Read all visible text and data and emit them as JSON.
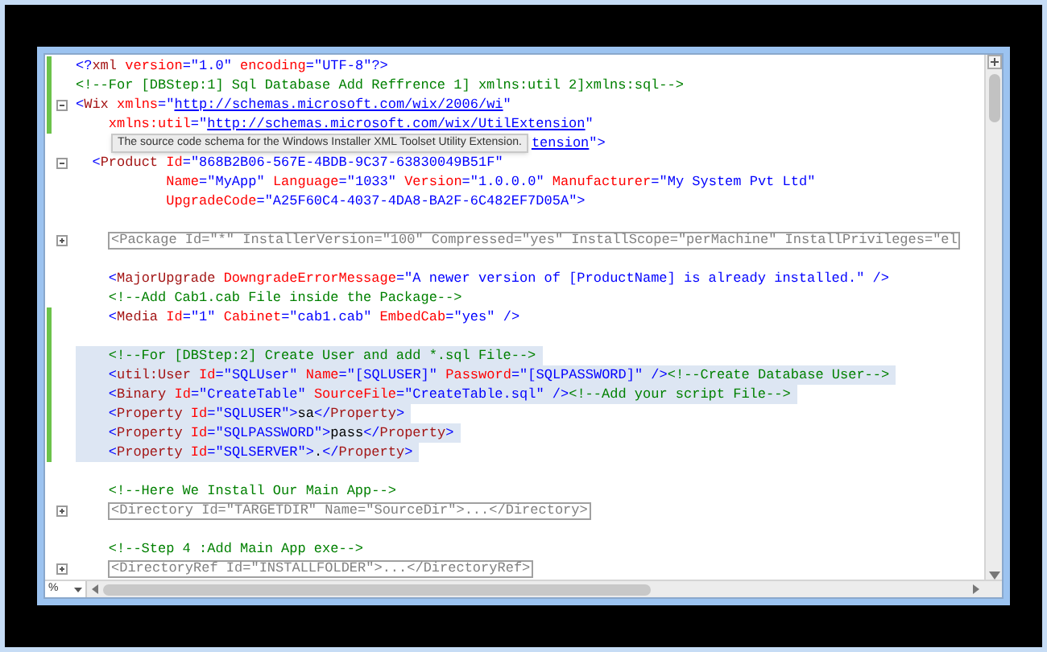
{
  "editor": {
    "lines": [
      {
        "changed": true,
        "segments": [
          {
            "kind": "delim",
            "text": "<?"
          },
          {
            "kind": "element",
            "text": "xml"
          },
          {
            "kind": "attr",
            "text": " version"
          },
          {
            "kind": "delim",
            "text": "=\""
          },
          {
            "kind": "value",
            "text": "1.0"
          },
          {
            "kind": "delim",
            "text": "\""
          },
          {
            "kind": "attr",
            "text": " encoding"
          },
          {
            "kind": "delim",
            "text": "=\""
          },
          {
            "kind": "value",
            "text": "UTF-8"
          },
          {
            "kind": "delim",
            "text": "\"?>"
          }
        ]
      },
      {
        "changed": true,
        "segments": [
          {
            "kind": "comment",
            "text": "<!--For [DBStep:1] Sql Database Add Reffrence 1] xmlns:util 2]xmlns:sql-->"
          }
        ]
      },
      {
        "changed": true,
        "expanded": true,
        "segments": [
          {
            "kind": "delim",
            "text": "<"
          },
          {
            "kind": "element",
            "text": "Wix"
          },
          {
            "kind": "attr",
            "text": " xmlns"
          },
          {
            "kind": "delim",
            "text": "=\""
          },
          {
            "kind": "link",
            "text": "http://schemas.microsoft.com/wix/2006/wi"
          },
          {
            "kind": "delim",
            "text": "\""
          }
        ]
      },
      {
        "changed": true,
        "segments": [
          {
            "kind": "attr",
            "text": "    xmlns:util"
          },
          {
            "kind": "delim",
            "text": "=\""
          },
          {
            "kind": "link",
            "text": "http://schemas.microsoft.com/wix/UtilExtension"
          },
          {
            "kind": "delim",
            "text": "\""
          }
        ]
      },
      {
        "changed": false,
        "tooltip": "The source code schema for the Windows Installer XML Toolset Utility Extension.",
        "segments": [
          {
            "kind": "link",
            "text": "tension"
          },
          {
            "kind": "delim",
            "text": "\">"
          }
        ]
      },
      {
        "changed": false,
        "expanded": true,
        "segments": [
          {
            "kind": "delim",
            "text": "  <"
          },
          {
            "kind": "element",
            "text": "Product"
          },
          {
            "kind": "attr",
            "text": " Id"
          },
          {
            "kind": "delim",
            "text": "=\""
          },
          {
            "kind": "value",
            "text": "868B2B06-567E-4BDB-9C37-63830049B51F"
          },
          {
            "kind": "delim",
            "text": "\""
          }
        ]
      },
      {
        "changed": false,
        "segments": [
          {
            "kind": "attr",
            "text": "           Name"
          },
          {
            "kind": "delim",
            "text": "=\""
          },
          {
            "kind": "value",
            "text": "MyApp"
          },
          {
            "kind": "delim",
            "text": "\""
          },
          {
            "kind": "attr",
            "text": " Language"
          },
          {
            "kind": "delim",
            "text": "=\""
          },
          {
            "kind": "value",
            "text": "1033"
          },
          {
            "kind": "delim",
            "text": "\""
          },
          {
            "kind": "attr",
            "text": " Version"
          },
          {
            "kind": "delim",
            "text": "=\""
          },
          {
            "kind": "value",
            "text": "1.0.0.0"
          },
          {
            "kind": "delim",
            "text": "\""
          },
          {
            "kind": "attr",
            "text": " Manufacturer"
          },
          {
            "kind": "delim",
            "text": "=\""
          },
          {
            "kind": "value",
            "text": "My System Pvt Ltd"
          },
          {
            "kind": "delim",
            "text": "\""
          }
        ]
      },
      {
        "changed": false,
        "segments": [
          {
            "kind": "attr",
            "text": "           UpgradeCode"
          },
          {
            "kind": "delim",
            "text": "=\""
          },
          {
            "kind": "value",
            "text": "A25F60C4-4037-4DA8-BA2F-6C482EF7D05A"
          },
          {
            "kind": "delim",
            "text": "\">"
          }
        ]
      },
      {
        "changed": false
      },
      {
        "changed": false,
        "expanded": false,
        "segments": [
          {
            "kind": "collapsed",
            "text": "<Package Id=\"*\" InstallerVersion=\"100\" Compressed=\"yes\" InstallScope=\"perMachine\" InstallPrivileges=\"el"
          }
        ]
      },
      {
        "changed": false
      },
      {
        "changed": false,
        "segments": [
          {
            "kind": "delim",
            "text": "    <"
          },
          {
            "kind": "element",
            "text": "MajorUpgrade"
          },
          {
            "kind": "attr",
            "text": " DowngradeErrorMessage"
          },
          {
            "kind": "delim",
            "text": "=\""
          },
          {
            "kind": "value",
            "text": "A newer version of [ProductName] is already installed."
          },
          {
            "kind": "delim",
            "text": "\" />"
          }
        ]
      },
      {
        "changed": false,
        "segments": [
          {
            "kind": "comment",
            "text": "    <!--Add Cab1.cab File inside the Package-->"
          }
        ]
      },
      {
        "changed": true,
        "segments": [
          {
            "kind": "delim",
            "text": "    <"
          },
          {
            "kind": "element",
            "text": "Media"
          },
          {
            "kind": "attr",
            "text": " Id"
          },
          {
            "kind": "delim",
            "text": "=\""
          },
          {
            "kind": "value",
            "text": "1"
          },
          {
            "kind": "delim",
            "text": "\""
          },
          {
            "kind": "attr",
            "text": " Cabinet"
          },
          {
            "kind": "delim",
            "text": "=\""
          },
          {
            "kind": "value",
            "text": "cab1.cab"
          },
          {
            "kind": "delim",
            "text": "\""
          },
          {
            "kind": "attr",
            "text": " EmbedCab"
          },
          {
            "kind": "delim",
            "text": "=\""
          },
          {
            "kind": "value",
            "text": "yes"
          },
          {
            "kind": "delim",
            "text": "\" />"
          }
        ]
      },
      {
        "changed": true
      },
      {
        "changed": true,
        "selected": true,
        "segments": [
          {
            "kind": "comment",
            "text": "    <!--For [DBStep:2] Create User and add *.sql File-->"
          }
        ]
      },
      {
        "changed": true,
        "selected": true,
        "segments": [
          {
            "kind": "delim",
            "text": "    <"
          },
          {
            "kind": "element",
            "text": "util:User"
          },
          {
            "kind": "attr",
            "text": " Id"
          },
          {
            "kind": "delim",
            "text": "=\""
          },
          {
            "kind": "value",
            "text": "SQLUser"
          },
          {
            "kind": "delim",
            "text": "\""
          },
          {
            "kind": "attr",
            "text": " Name"
          },
          {
            "kind": "delim",
            "text": "=\""
          },
          {
            "kind": "value",
            "text": "[SQLUSER]"
          },
          {
            "kind": "delim",
            "text": "\""
          },
          {
            "kind": "attr",
            "text": " Password"
          },
          {
            "kind": "delim",
            "text": "=\""
          },
          {
            "kind": "value",
            "text": "[SQLPASSWORD]"
          },
          {
            "kind": "delim",
            "text": "\" />"
          },
          {
            "kind": "comment",
            "text": "<!--Create Database User-->"
          }
        ]
      },
      {
        "changed": true,
        "selected": true,
        "segments": [
          {
            "kind": "delim",
            "text": "    <"
          },
          {
            "kind": "element",
            "text": "Binary"
          },
          {
            "kind": "attr",
            "text": " Id"
          },
          {
            "kind": "delim",
            "text": "=\""
          },
          {
            "kind": "value",
            "text": "CreateTable"
          },
          {
            "kind": "delim",
            "text": "\""
          },
          {
            "kind": "attr",
            "text": " SourceFile"
          },
          {
            "kind": "delim",
            "text": "=\""
          },
          {
            "kind": "value",
            "text": "CreateTable.sql"
          },
          {
            "kind": "delim",
            "text": "\" />"
          },
          {
            "kind": "comment",
            "text": "<!--Add your script File-->"
          }
        ]
      },
      {
        "changed": true,
        "selected": true,
        "segments": [
          {
            "kind": "delim",
            "text": "    <"
          },
          {
            "kind": "element",
            "text": "Property"
          },
          {
            "kind": "attr",
            "text": " Id"
          },
          {
            "kind": "delim",
            "text": "=\""
          },
          {
            "kind": "value",
            "text": "SQLUSER"
          },
          {
            "kind": "delim",
            "text": "\">"
          },
          {
            "kind": "text",
            "text": "sa"
          },
          {
            "kind": "delim",
            "text": "</"
          },
          {
            "kind": "element",
            "text": "Property"
          },
          {
            "kind": "delim",
            "text": ">"
          }
        ]
      },
      {
        "changed": true,
        "selected": true,
        "segments": [
          {
            "kind": "delim",
            "text": "    <"
          },
          {
            "kind": "element",
            "text": "Property"
          },
          {
            "kind": "attr",
            "text": " Id"
          },
          {
            "kind": "delim",
            "text": "=\""
          },
          {
            "kind": "value",
            "text": "SQLPASSWORD"
          },
          {
            "kind": "delim",
            "text": "\">"
          },
          {
            "kind": "text",
            "text": "pass"
          },
          {
            "kind": "delim",
            "text": "</"
          },
          {
            "kind": "element",
            "text": "Property"
          },
          {
            "kind": "delim",
            "text": ">"
          }
        ]
      },
      {
        "changed": true,
        "selected": true,
        "segments": [
          {
            "kind": "delim",
            "text": "    <"
          },
          {
            "kind": "element",
            "text": "Property"
          },
          {
            "kind": "attr",
            "text": " Id"
          },
          {
            "kind": "delim",
            "text": "=\""
          },
          {
            "kind": "value",
            "text": "SQLSERVER"
          },
          {
            "kind": "delim",
            "text": "\">"
          },
          {
            "kind": "text",
            "text": "."
          },
          {
            "kind": "delim",
            "text": "</"
          },
          {
            "kind": "element",
            "text": "Property"
          },
          {
            "kind": "delim",
            "text": ">"
          }
        ]
      },
      {
        "changed": false
      },
      {
        "changed": false,
        "segments": [
          {
            "kind": "comment",
            "text": "    <!--Here We Install Our Main App-->"
          }
        ]
      },
      {
        "changed": false,
        "expanded": false,
        "segments": [
          {
            "kind": "collapsed",
            "text": "<Directory Id=\"TARGETDIR\" Name=\"SourceDir\">...</Directory>"
          }
        ]
      },
      {
        "changed": false
      },
      {
        "changed": false,
        "segments": [
          {
            "kind": "comment",
            "text": "    <!--Step 4 :Add Main App exe-->"
          }
        ]
      },
      {
        "changed": false,
        "expanded": false,
        "segments": [
          {
            "kind": "collapsed",
            "text": "<DirectoryRef Id=\"INSTALLFOLDER\">...</DirectoryRef>"
          }
        ]
      }
    ]
  },
  "status_bar": {
    "zoom": "%"
  }
}
